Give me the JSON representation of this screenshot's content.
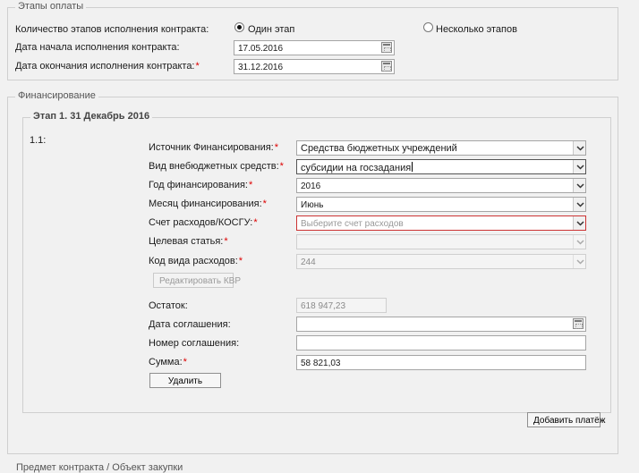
{
  "payment_stages": {
    "legend": "Этапы оплаты",
    "stage_count_label": "Количество этапов исполнения контракта:",
    "option_single": "Один этап",
    "option_multiple": "Несколько этапов",
    "selected_option": "Один этап",
    "start_date_label": "Дата начала исполнения контракта:",
    "start_date_value": "17.05.2016",
    "end_date_label": "Дата окончания исполнения контракта:",
    "end_date_value": "31.12.2016"
  },
  "financing": {
    "legend": "Финансирование",
    "stage": {
      "legend": "Этап 1. 31 Декабрь 2016",
      "item_number": "1.1:",
      "fields": {
        "source_label": "Источник Финансирования:",
        "source_value": "Средства бюджетных учреждений",
        "extrabudget_label": "Вид внебюджетных средств:",
        "extrabudget_value": "субсидии на госзадания",
        "year_label": "Год финансирования:",
        "year_value": "2016",
        "month_label": "Месяц финансирования:",
        "month_value": "Июнь",
        "account_label": "Счет расходов/КОСГУ:",
        "account_placeholder": "Выберите счет расходов",
        "target_label": "Целевая статья:",
        "target_value": "",
        "expense_code_label": "Код вида расходов:",
        "expense_code_value": "244",
        "edit_kvr_button": "Редактировать КВР",
        "balance_label": "Остаток:",
        "balance_value": "618 947,23",
        "agreement_date_label": "Дата соглашения:",
        "agreement_date_value": "",
        "agreement_number_label": "Номер соглашения:",
        "agreement_number_value": "",
        "sum_label": "Сумма:",
        "sum_value": "58 821,03",
        "delete_button": "Удалить"
      }
    },
    "add_payment_button": "Добавить платёж"
  },
  "next_section_partial": "Предмет контракта / Объект закупки"
}
